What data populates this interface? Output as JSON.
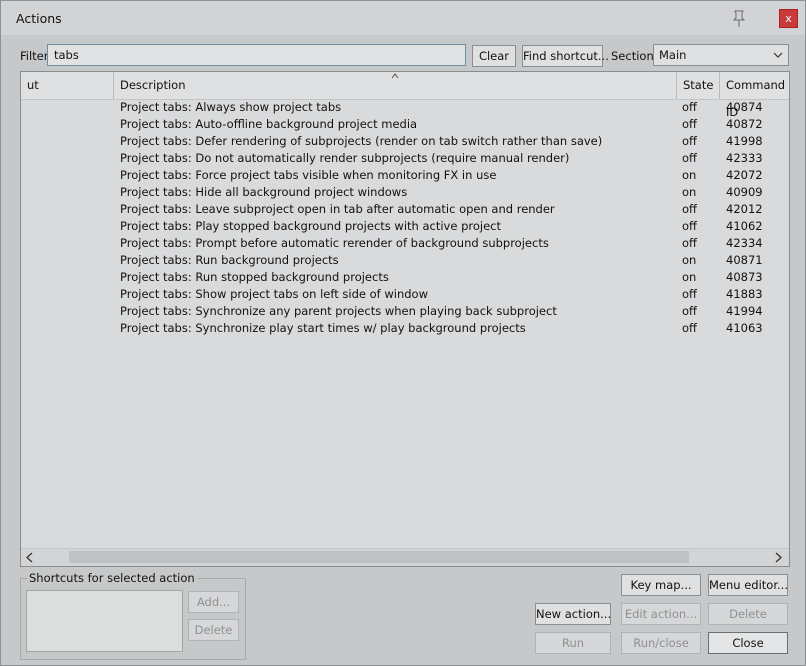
{
  "window": {
    "title": "Actions"
  },
  "filter": {
    "label": "Filter:",
    "value": "tabs"
  },
  "buttons": {
    "clear": "Clear",
    "find_shortcut": "Find shortcut...",
    "key_map": "Key map...",
    "menu_editor": "Menu editor...",
    "new_action": "New action...",
    "edit_action": "Edit action...",
    "delete": "Delete",
    "run": "Run",
    "run_close": "Run/close",
    "close": "Close",
    "add": "Add...",
    "delete_shortcut": "Delete"
  },
  "section": {
    "label": "Section:",
    "value": "Main"
  },
  "table": {
    "columns": [
      "ut",
      "Description",
      "State",
      "Command ID"
    ],
    "rows": [
      {
        "description": "Project tabs: Always show project tabs",
        "state": "off",
        "id": "40874"
      },
      {
        "description": "Project tabs: Auto-offline background project media",
        "state": "off",
        "id": "40872"
      },
      {
        "description": "Project tabs: Defer rendering of subprojects (render on tab switch rather than save)",
        "state": "off",
        "id": "41998"
      },
      {
        "description": "Project tabs: Do not automatically render subprojects (require manual render)",
        "state": "off",
        "id": "42333"
      },
      {
        "description": "Project tabs: Force project tabs visible when monitoring FX in use",
        "state": "on",
        "id": "42072"
      },
      {
        "description": "Project tabs: Hide all background project windows",
        "state": "on",
        "id": "40909"
      },
      {
        "description": "Project tabs: Leave subproject open in tab after automatic open and render",
        "state": "off",
        "id": "42012"
      },
      {
        "description": "Project tabs: Play stopped background projects with active project",
        "state": "off",
        "id": "41062"
      },
      {
        "description": "Project tabs: Prompt before automatic rerender of background subprojects",
        "state": "off",
        "id": "42334"
      },
      {
        "description": "Project tabs: Run background projects",
        "state": "on",
        "id": "40871"
      },
      {
        "description": "Project tabs: Run stopped background projects",
        "state": "on",
        "id": "40873"
      },
      {
        "description": "Project tabs: Show project tabs on left side of window",
        "state": "off",
        "id": "41883"
      },
      {
        "description": "Project tabs: Synchronize any parent projects when playing back subproject",
        "state": "off",
        "id": "41994"
      },
      {
        "description": "Project tabs: Synchronize play start times w/ play background projects",
        "state": "off",
        "id": "41063"
      }
    ]
  },
  "shortcuts": {
    "group_title": "Shortcuts for selected action"
  },
  "icons": {
    "pin": "pin-icon",
    "close": "close-icon",
    "close_glyph": "x"
  }
}
